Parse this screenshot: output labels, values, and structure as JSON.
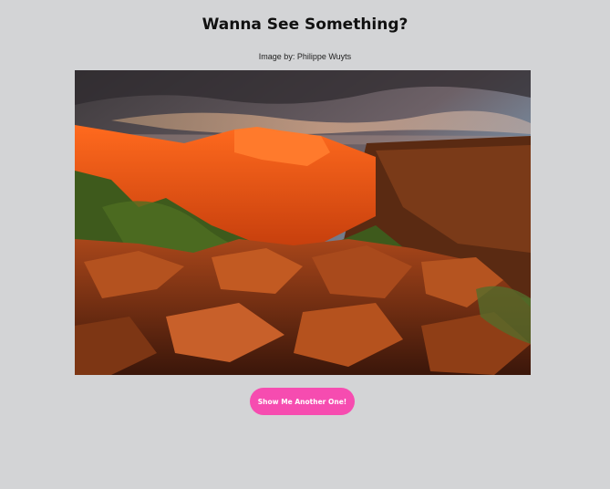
{
  "header": {
    "title": "Wanna See Something?"
  },
  "image": {
    "credit": "Image by: Philippe Wuyts"
  },
  "actions": {
    "show_another_label": "Show Me Another One!",
    "button_color": "#f64cb0"
  },
  "colors": {
    "background": "#d3d4d6"
  }
}
